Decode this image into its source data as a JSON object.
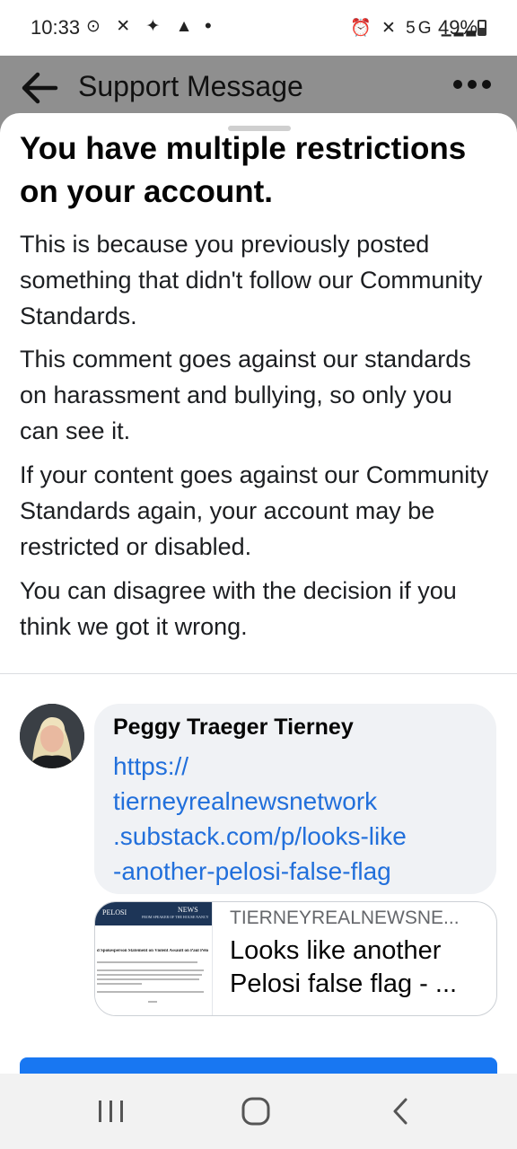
{
  "status_bar": {
    "time": "10:33",
    "left_icons": "⊙ ✕ ✦ ▲",
    "network": "5G",
    "battery": "49%"
  },
  "header": {
    "title": "Support Message"
  },
  "sheet": {
    "heading": "You have multiple restrictions on your account.",
    "paragraphs": [
      "This is because you previously posted something that didn't follow our Community Standards.",
      "This comment goes against our standards on harassment and bullying, so only you can see it.",
      "If your content goes against our Community Standards again, your account may be restricted or disabled.",
      "You can disagree with the decision if you think we got it wrong."
    ]
  },
  "comment": {
    "author": "Peggy Traeger Tierney",
    "link_text": "https://\ntierneyrealnewsnetwork\n.substack.com/p/looks-like\n-another-pelosi-false-flag"
  },
  "link_preview": {
    "domain": "TIERNEYREALNEWSNE...",
    "title": "Looks like another Pelosi false flag - ...",
    "thumb_header": "NEWS",
    "thumb_brand": "PELOSI",
    "thumb_sub": "FROM SPEAKER OF THE HOUSE NANCY",
    "thumb_headline": "d Spokesperson Statement on Violent Assault on Paul Pelo"
  },
  "colors": {
    "link": "#216fdb",
    "primary": "#1877f2"
  }
}
